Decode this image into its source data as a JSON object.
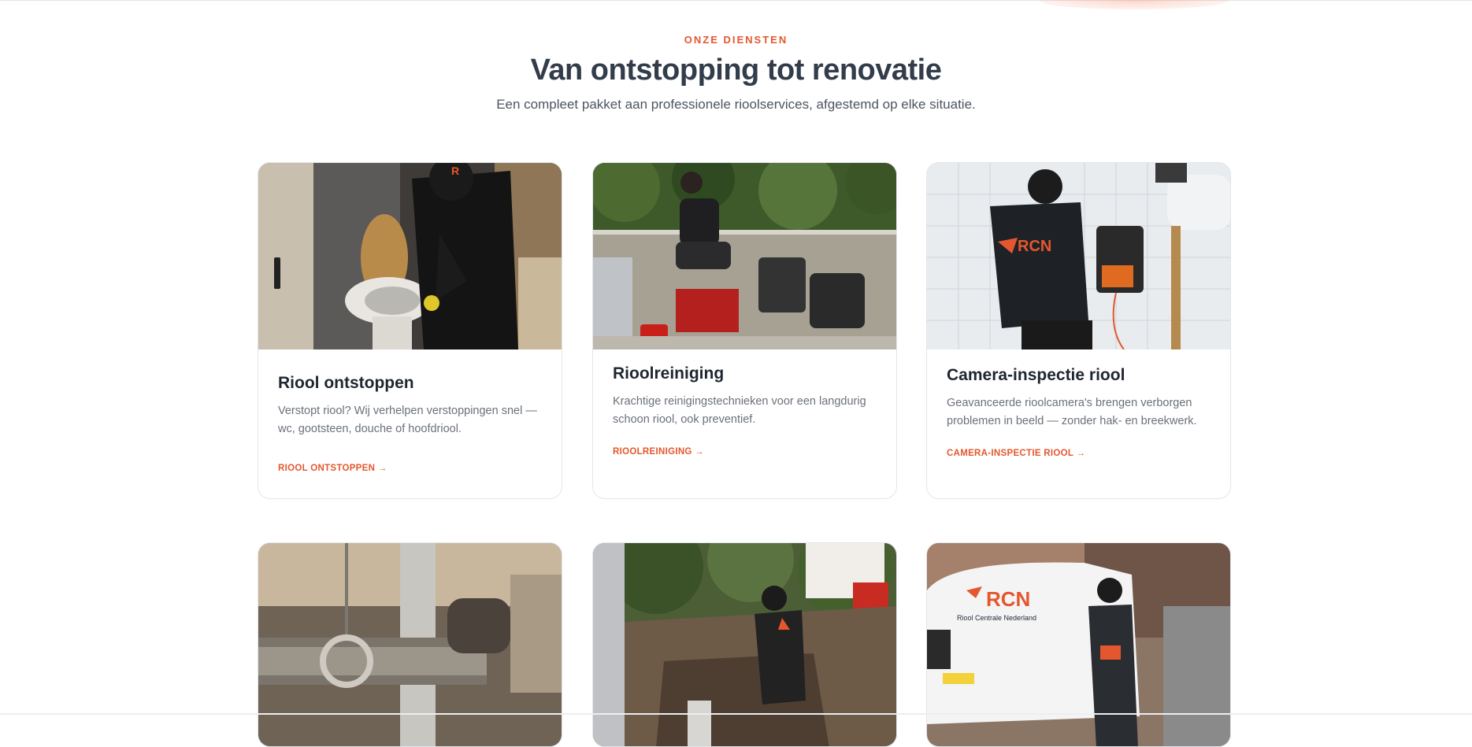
{
  "header": {
    "eyebrow": "ONZE DIENSTEN",
    "title": "Van ontstopping tot renovatie",
    "subtitle": "Een compleet pakket aan professionele rioolservices, afgestemd op elke situatie."
  },
  "services": [
    {
      "title": "Riool ontstoppen",
      "description": "Verstopt riool? Wij verhelpen verstoppingen snel — wc, gootsteen, douche of hoofdriool.",
      "link": "RIOOL ONTSTOPPEN →",
      "photo": "technician-unclogging-toilet"
    },
    {
      "title": "Rioolreiniging",
      "description": "Krachtige reinigingstechnieken voor een langdurig schoon riool, ook preventief.",
      "link": "RIOOLREINIGING →",
      "photo": "technician-with-cleaning-equipment"
    },
    {
      "title": "Camera-inspectie riool",
      "description": "Geavanceerde rioolcamera's brengen verborgen problemen in beeld — zonder hak- en breekwerk.",
      "link": "CAMERA-INSPECTIE RIOOL →",
      "photo": "technician-with-sewer-camera"
    },
    {
      "photo": "pipe-installation"
    },
    {
      "photo": "excavation-work"
    },
    {
      "photo": "service-van-and-technician",
      "van_brand": "RCN",
      "van_subtitle": "Riool Centrale Nederland"
    }
  ],
  "colors": {
    "accent": "#e4572e",
    "heading": "#323c4a",
    "body_text": "#6b717a",
    "card_border": "#e3e5e9"
  }
}
